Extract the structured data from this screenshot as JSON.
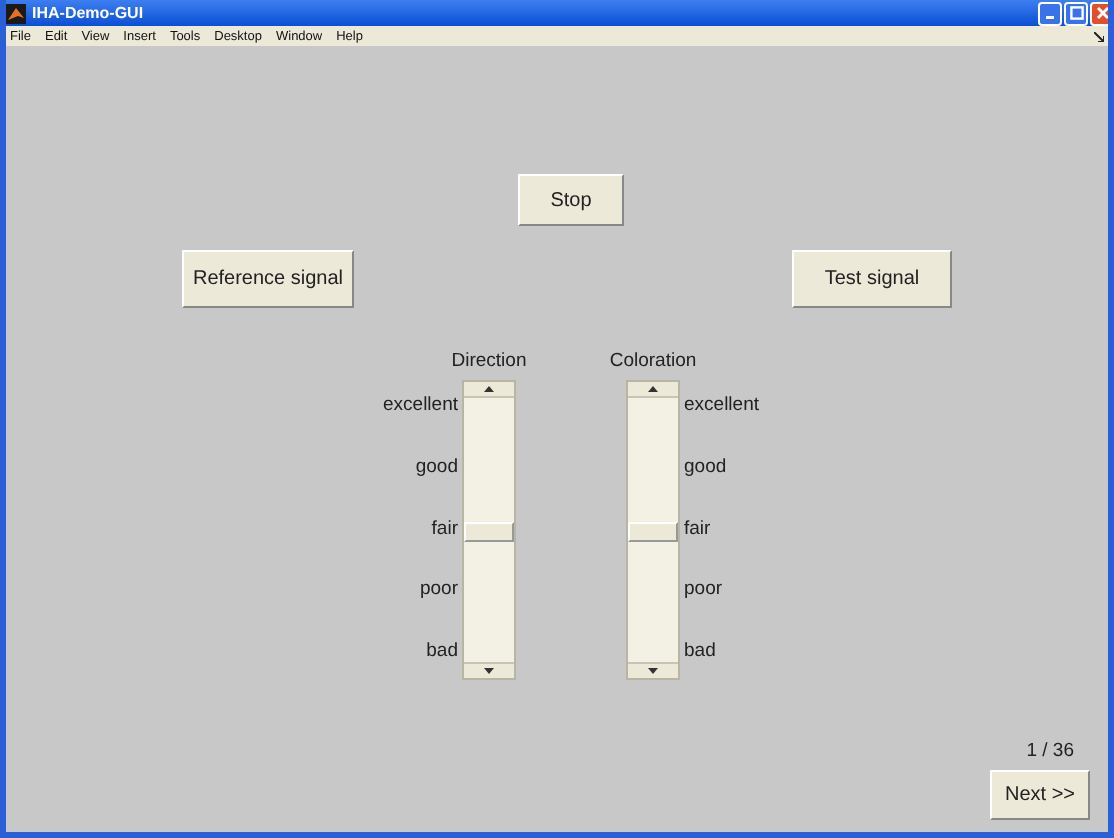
{
  "window": {
    "title": "IHA-Demo-GUI"
  },
  "menu": [
    "File",
    "Edit",
    "View",
    "Insert",
    "Tools",
    "Desktop",
    "Window",
    "Help"
  ],
  "stop_button": "Stop",
  "reference_button": "Reference signal",
  "test_button": "Test signal",
  "sliders": [
    {
      "title": "Direction",
      "kind": "left",
      "level": 0.5,
      "labels": [
        "excellent",
        "good",
        "fair",
        "poor",
        "bad"
      ]
    },
    {
      "title": "Coloration",
      "kind": "right",
      "level": 0.5,
      "labels": [
        "excellent",
        "good",
        "fair",
        "poor",
        "bad"
      ]
    }
  ],
  "page_counter": "1 / 36",
  "next_button": "Next >>"
}
